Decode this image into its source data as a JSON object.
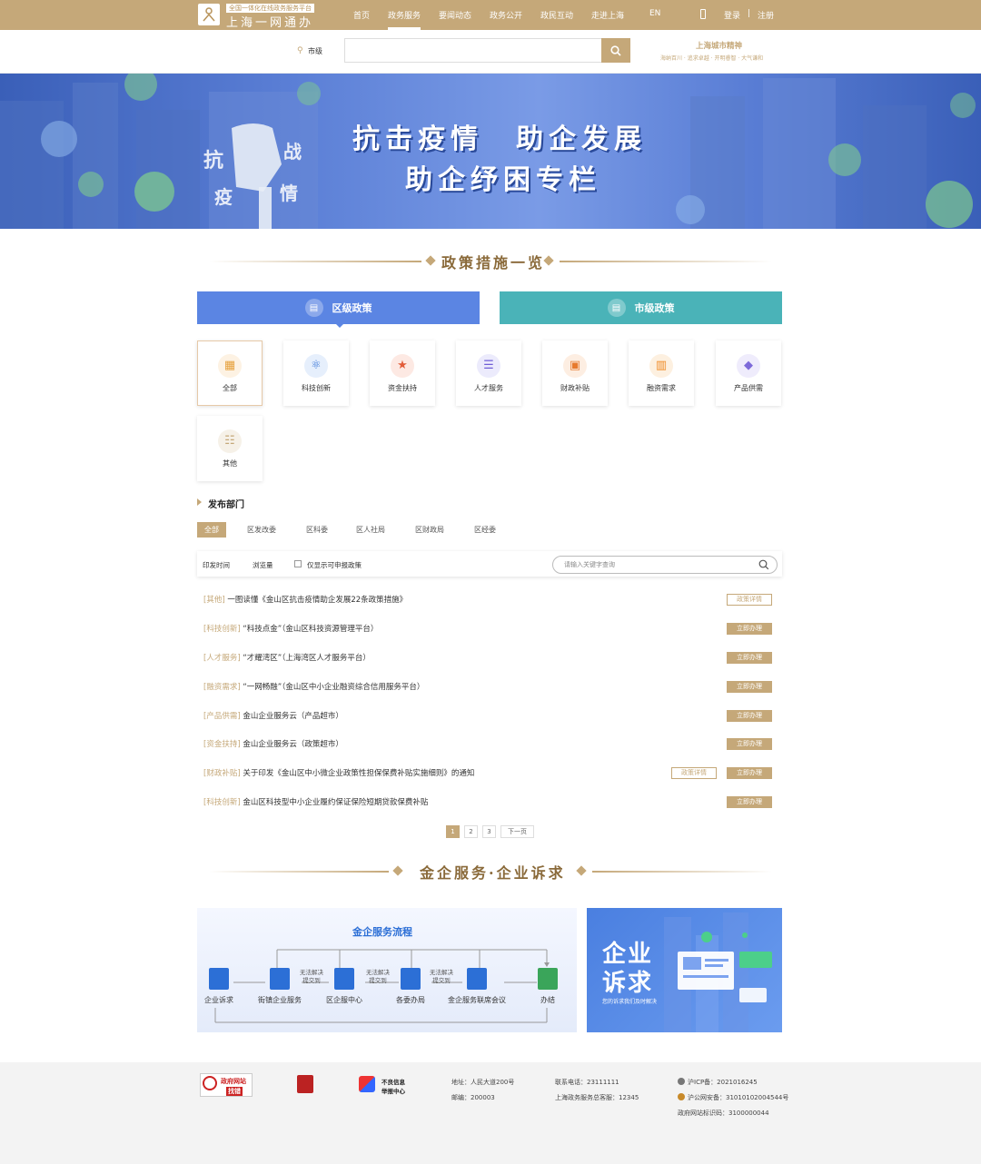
{
  "header": {
    "logo_sub": "全国一体化在线政务服务平台",
    "logo_title": "上海一网通办",
    "nav": [
      "首页",
      "政务服务",
      "要闻动态",
      "政务公开",
      "政民互动",
      "走进上海",
      "EN"
    ],
    "login": "登录",
    "divider": "|",
    "register": "注册",
    "mobile_icon": "mobile-icon"
  },
  "search": {
    "location": "市级",
    "placeholder": "",
    "slogan_title": "上海城市精神",
    "slogan_sub": "海纳百川 · 追求卓越 · 开明睿智 · 大气谦和"
  },
  "banner": {
    "line1": "抗击疫情　助企发展",
    "line2": "助企纾困专栏"
  },
  "section1_title": "政策措施一览",
  "tabs": [
    {
      "label": "区级政策",
      "color": "#5b85e3"
    },
    {
      "label": "市级政策",
      "color": "#4ab3b8"
    }
  ],
  "categories": [
    {
      "label": "全部",
      "icon": "grid-icon",
      "color": "#e6a13d"
    },
    {
      "label": "科技创新",
      "icon": "atom-icon",
      "color": "#3e7ad9"
    },
    {
      "label": "资金扶持",
      "icon": "money-icon",
      "color": "#e25d3a"
    },
    {
      "label": "人才服务",
      "icon": "talent-icon",
      "color": "#6f5fd6"
    },
    {
      "label": "财政补贴",
      "icon": "subsidy-icon",
      "color": "#e77a2e"
    },
    {
      "label": "融资需求",
      "icon": "finance-icon",
      "color": "#f08c28"
    },
    {
      "label": "产品供需",
      "icon": "box-icon",
      "color": "#7d6ad9"
    },
    {
      "label": "其他",
      "icon": "list-icon",
      "color": "#c5a879"
    }
  ],
  "dept_title": "发布部门",
  "departments": [
    "全部",
    "区发改委",
    "区科委",
    "区人社局",
    "区财政局",
    "区经委"
  ],
  "filters": {
    "sort_date": "印发时间",
    "sort_views": "浏览量",
    "only_applicable": "仅显示可申报政策",
    "search_placeholder": "请输入关键字查询"
  },
  "policies": [
    {
      "tag": "[其他]",
      "text": "一图读懂《金山区抗击疫情助企发展22条政策措施》",
      "detail": "政策详情",
      "apply": ""
    },
    {
      "tag": "[科技创新]",
      "text": "“科技点金”（金山区科技资源管理平台）",
      "detail": "",
      "apply": "立即办理"
    },
    {
      "tag": "[人才服务]",
      "text": "“才耀湾区”（上海湾区人才服务平台）",
      "detail": "",
      "apply": "立即办理"
    },
    {
      "tag": "[融资需求]",
      "text": "“一网畅融”（金山区中小企业融资综合信用服务平台）",
      "detail": "",
      "apply": "立即办理"
    },
    {
      "tag": "[产品供需]",
      "text": "金山企业服务云（产品超市）",
      "detail": "",
      "apply": "立即办理"
    },
    {
      "tag": "[资金扶持]",
      "text": "金山企业服务云（政策超市）",
      "detail": "",
      "apply": "立即办理"
    },
    {
      "tag": "[财政补贴]",
      "text": "关于印发《金山区中小微企业政策性担保保费补贴实施细则》的通知",
      "detail": "政策详情",
      "apply": "立即办理"
    },
    {
      "tag": "[科技创新]",
      "text": "金山区科技型中小企业履约保证保险短期贷款保费补贴",
      "detail": "",
      "apply": "立即办理"
    }
  ],
  "pagination": {
    "pages": [
      "1",
      "2",
      "3"
    ],
    "next": "下一页",
    "current": "1"
  },
  "section2_title": "金企服务·企业诉求",
  "flow": {
    "title": "金企服务流程",
    "nodes": [
      "企业诉求",
      "街镇企业服务",
      "区企服中心",
      "各委办局",
      "金企服务联席会议",
      "办结"
    ],
    "note_top": "无法解决",
    "note_bottom": "提交到"
  },
  "appeal": {
    "title1": "企业",
    "title2": "诉求",
    "sub": "您的诉求我们及时解决"
  },
  "footer": {
    "gov_find_error": "政府网站",
    "gov_find_error2": "找错",
    "bad_info1": "不良信息",
    "bad_info2": "举报中心",
    "address": "地址：人民大道200号",
    "postcode": "邮编：200003",
    "phone": "联系电话：23111111",
    "hotline": "上海政务服务总客服：12345",
    "icp": "沪ICP备：2021016245",
    "police": "沪公网安备：31010102004544号",
    "site_id": "政府网站标识码：3100000044"
  }
}
